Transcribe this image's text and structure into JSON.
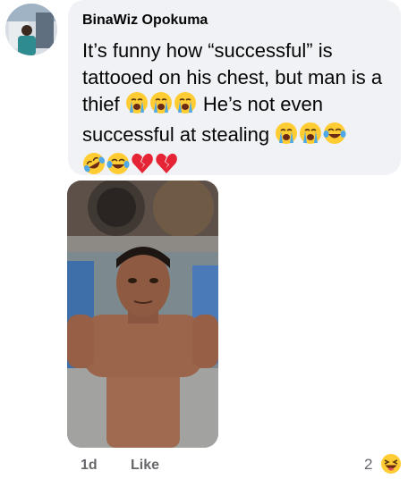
{
  "comment": {
    "author": "BinaWiz Opokuma",
    "text_segments": [
      "It’s funny how “successful” is tattooed on his chest, but man is a thief ",
      " He’s not even successful at stealing "
    ],
    "emoji": {
      "crying": "loudly-crying-face",
      "laughing": "face-with-tears-of-joy",
      "rolling": "rolling-on-the-floor-laughing",
      "broken_heart": "broken-heart"
    }
  },
  "footer": {
    "time": "1d",
    "like_label": "Like",
    "reaction_count": "2",
    "reaction_icon": "haha-reaction-icon"
  },
  "colors": {
    "bubble": "#f0f2f5",
    "meta_text": "#65676b",
    "emoji_yellow": "#ffcc33",
    "tear_blue": "#4fa9e8",
    "heart_red": "#e52535"
  }
}
